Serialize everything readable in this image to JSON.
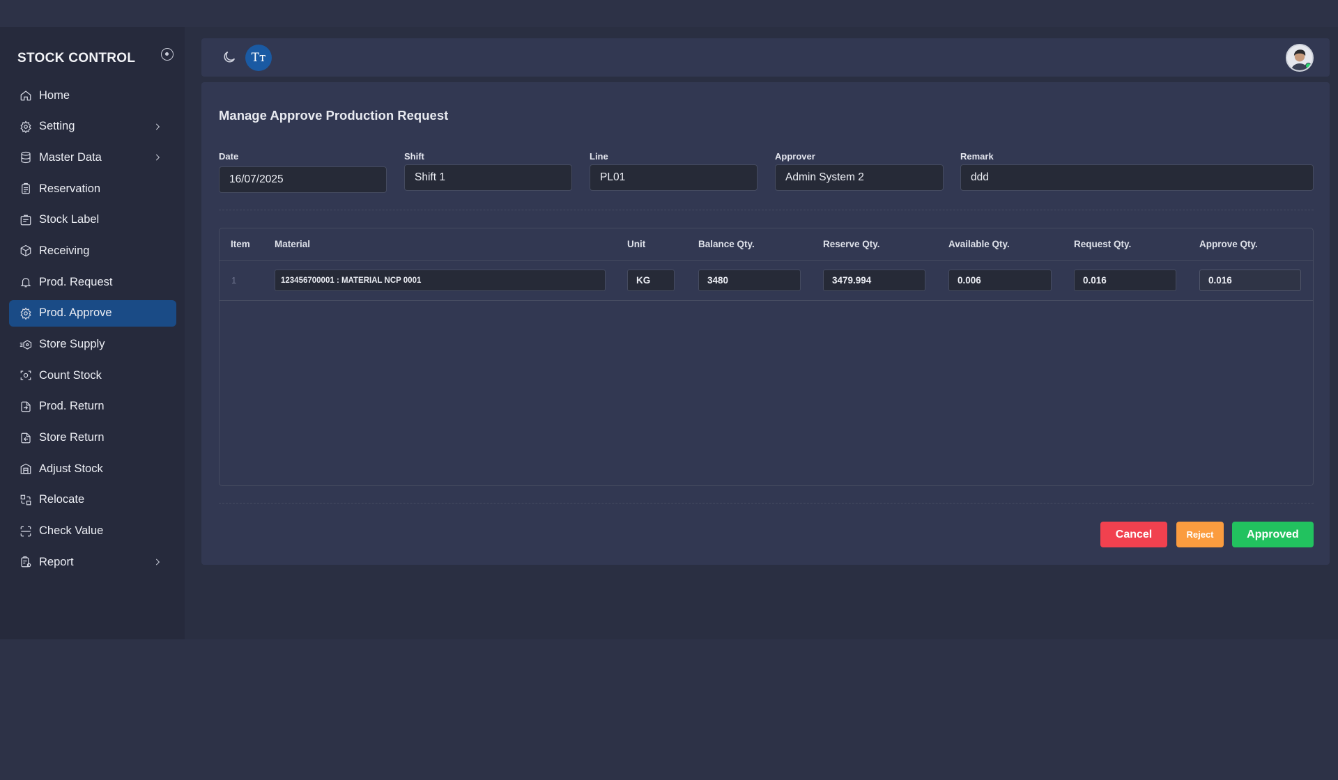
{
  "brand": "STOCK CONTROL",
  "sidebar": {
    "items": [
      {
        "label": "Home",
        "icon": "home-icon"
      },
      {
        "label": "Setting",
        "icon": "gear-icon"
      },
      {
        "label": "Master Data",
        "icon": "database-icon"
      },
      {
        "label": "Reservation",
        "icon": "clipboard-icon"
      },
      {
        "label": "Stock Label",
        "icon": "label-icon"
      },
      {
        "label": "Receiving",
        "icon": "box-icon"
      },
      {
        "label": "Prod. Request",
        "icon": "bell-icon"
      },
      {
        "label": "Prod. Approve",
        "icon": "gear-icon"
      },
      {
        "label": "Store Supply",
        "icon": "supply-icon"
      },
      {
        "label": "Count Stock",
        "icon": "scan-icon"
      },
      {
        "label": "Prod. Return",
        "icon": "return-in-icon"
      },
      {
        "label": "Store Return",
        "icon": "return-out-icon"
      },
      {
        "label": "Adjust Stock",
        "icon": "warehouse-icon"
      },
      {
        "label": "Relocate",
        "icon": "relocate-icon"
      },
      {
        "label": "Check Value",
        "icon": "check-scan-icon"
      },
      {
        "label": "Report",
        "icon": "report-icon"
      }
    ],
    "active": "Prod. Approve"
  },
  "topbar": {
    "font_button_label": "Tт"
  },
  "page": {
    "title": "Manage Approve Production Request",
    "fields": {
      "date": {
        "label": "Date",
        "value": "16/07/2025"
      },
      "shift": {
        "label": "Shift",
        "value": "Shift 1"
      },
      "line": {
        "label": "Line",
        "value": "PL01"
      },
      "approver": {
        "label": "Approver",
        "value": "Admin System 2"
      },
      "remark": {
        "label": "Remark",
        "value": "ddd"
      }
    }
  },
  "table": {
    "headers": [
      "Item",
      "Material",
      "Unit",
      "Balance Qty.",
      "Reserve Qty.",
      "Available Qty.",
      "Request Qty.",
      "Approve Qty."
    ],
    "rows": [
      {
        "item": "1",
        "material": "123456700001 : MATERIAL NCP 0001",
        "unit": "KG",
        "balance": "3480",
        "reserve": "3479.994",
        "available": "0.006",
        "request": "0.016",
        "approve": "0.016"
      }
    ]
  },
  "actions": {
    "cancel": "Cancel",
    "reject": "Reject",
    "approve": "Approved"
  },
  "colors": {
    "accent": "#1a4b86",
    "cancel": "#f1414f",
    "reject": "#fb9c3f",
    "approve": "#22c25f",
    "online": "#2bd26f"
  }
}
